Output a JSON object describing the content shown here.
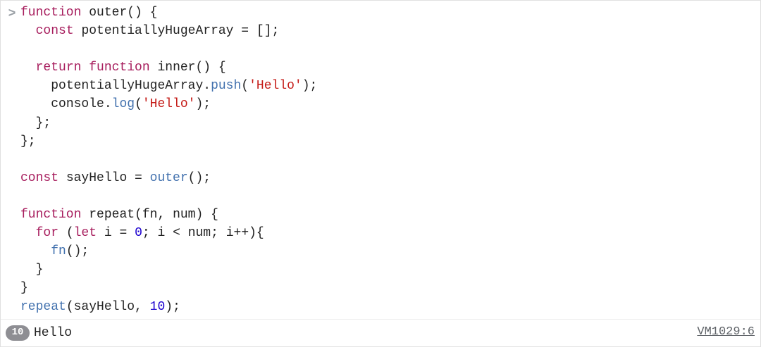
{
  "input": {
    "prompt": ">",
    "tokens": [
      {
        "t": "function",
        "c": "tok-kw"
      },
      {
        "t": " ",
        "c": ""
      },
      {
        "t": "outer",
        "c": "tok-decl"
      },
      {
        "t": "() {",
        "c": "tok-punc"
      },
      {
        "t": "\n  ",
        "c": ""
      },
      {
        "t": "const",
        "c": "tok-kw"
      },
      {
        "t": " ",
        "c": ""
      },
      {
        "t": "potentiallyHugeArray",
        "c": "tok-decl"
      },
      {
        "t": " = [];",
        "c": "tok-punc"
      },
      {
        "t": "\n\n  ",
        "c": ""
      },
      {
        "t": "return",
        "c": "tok-kw"
      },
      {
        "t": " ",
        "c": ""
      },
      {
        "t": "function",
        "c": "tok-kw"
      },
      {
        "t": " ",
        "c": ""
      },
      {
        "t": "inner",
        "c": "tok-decl"
      },
      {
        "t": "() {",
        "c": "tok-punc"
      },
      {
        "t": "\n    ",
        "c": ""
      },
      {
        "t": "potentiallyHugeArray",
        "c": "tok-decl"
      },
      {
        "t": ".",
        "c": "tok-punc"
      },
      {
        "t": "push",
        "c": "tok-fn"
      },
      {
        "t": "(",
        "c": "tok-punc"
      },
      {
        "t": "'Hello'",
        "c": "tok-str"
      },
      {
        "t": ");",
        "c": "tok-punc"
      },
      {
        "t": "\n    ",
        "c": ""
      },
      {
        "t": "console",
        "c": "tok-decl"
      },
      {
        "t": ".",
        "c": "tok-punc"
      },
      {
        "t": "log",
        "c": "tok-fn"
      },
      {
        "t": "(",
        "c": "tok-punc"
      },
      {
        "t": "'Hello'",
        "c": "tok-str"
      },
      {
        "t": ");",
        "c": "tok-punc"
      },
      {
        "t": "\n  };",
        "c": "tok-punc"
      },
      {
        "t": "\n};",
        "c": "tok-punc"
      },
      {
        "t": "\n\n",
        "c": ""
      },
      {
        "t": "const",
        "c": "tok-kw"
      },
      {
        "t": " ",
        "c": ""
      },
      {
        "t": "sayHello",
        "c": "tok-decl"
      },
      {
        "t": " = ",
        "c": "tok-punc"
      },
      {
        "t": "outer",
        "c": "tok-fn"
      },
      {
        "t": "();",
        "c": "tok-punc"
      },
      {
        "t": "\n\n",
        "c": ""
      },
      {
        "t": "function",
        "c": "tok-kw"
      },
      {
        "t": " ",
        "c": ""
      },
      {
        "t": "repeat",
        "c": "tok-decl"
      },
      {
        "t": "(",
        "c": "tok-punc"
      },
      {
        "t": "fn",
        "c": "tok-decl"
      },
      {
        "t": ", ",
        "c": "tok-punc"
      },
      {
        "t": "num",
        "c": "tok-decl"
      },
      {
        "t": ") {",
        "c": "tok-punc"
      },
      {
        "t": "\n  ",
        "c": ""
      },
      {
        "t": "for",
        "c": "tok-kw"
      },
      {
        "t": " (",
        "c": "tok-punc"
      },
      {
        "t": "let",
        "c": "tok-kw"
      },
      {
        "t": " ",
        "c": ""
      },
      {
        "t": "i",
        "c": "tok-decl"
      },
      {
        "t": " = ",
        "c": "tok-punc"
      },
      {
        "t": "0",
        "c": "tok-num"
      },
      {
        "t": "; ",
        "c": "tok-punc"
      },
      {
        "t": "i",
        "c": "tok-decl"
      },
      {
        "t": " < ",
        "c": "tok-op"
      },
      {
        "t": "num",
        "c": "tok-decl"
      },
      {
        "t": "; ",
        "c": "tok-punc"
      },
      {
        "t": "i",
        "c": "tok-decl"
      },
      {
        "t": "++){",
        "c": "tok-punc"
      },
      {
        "t": "\n    ",
        "c": ""
      },
      {
        "t": "fn",
        "c": "tok-fn"
      },
      {
        "t": "();",
        "c": "tok-punc"
      },
      {
        "t": "\n  }",
        "c": "tok-punc"
      },
      {
        "t": "\n}",
        "c": "tok-punc"
      },
      {
        "t": "\n",
        "c": ""
      },
      {
        "t": "repeat",
        "c": "tok-fn"
      },
      {
        "t": "(",
        "c": "tok-punc"
      },
      {
        "t": "sayHello",
        "c": "tok-decl"
      },
      {
        "t": ", ",
        "c": "tok-punc"
      },
      {
        "t": "10",
        "c": "tok-num"
      },
      {
        "t": ");",
        "c": "tok-punc"
      }
    ]
  },
  "output": {
    "count": "10",
    "message": "Hello",
    "source": "VM1029:6"
  }
}
